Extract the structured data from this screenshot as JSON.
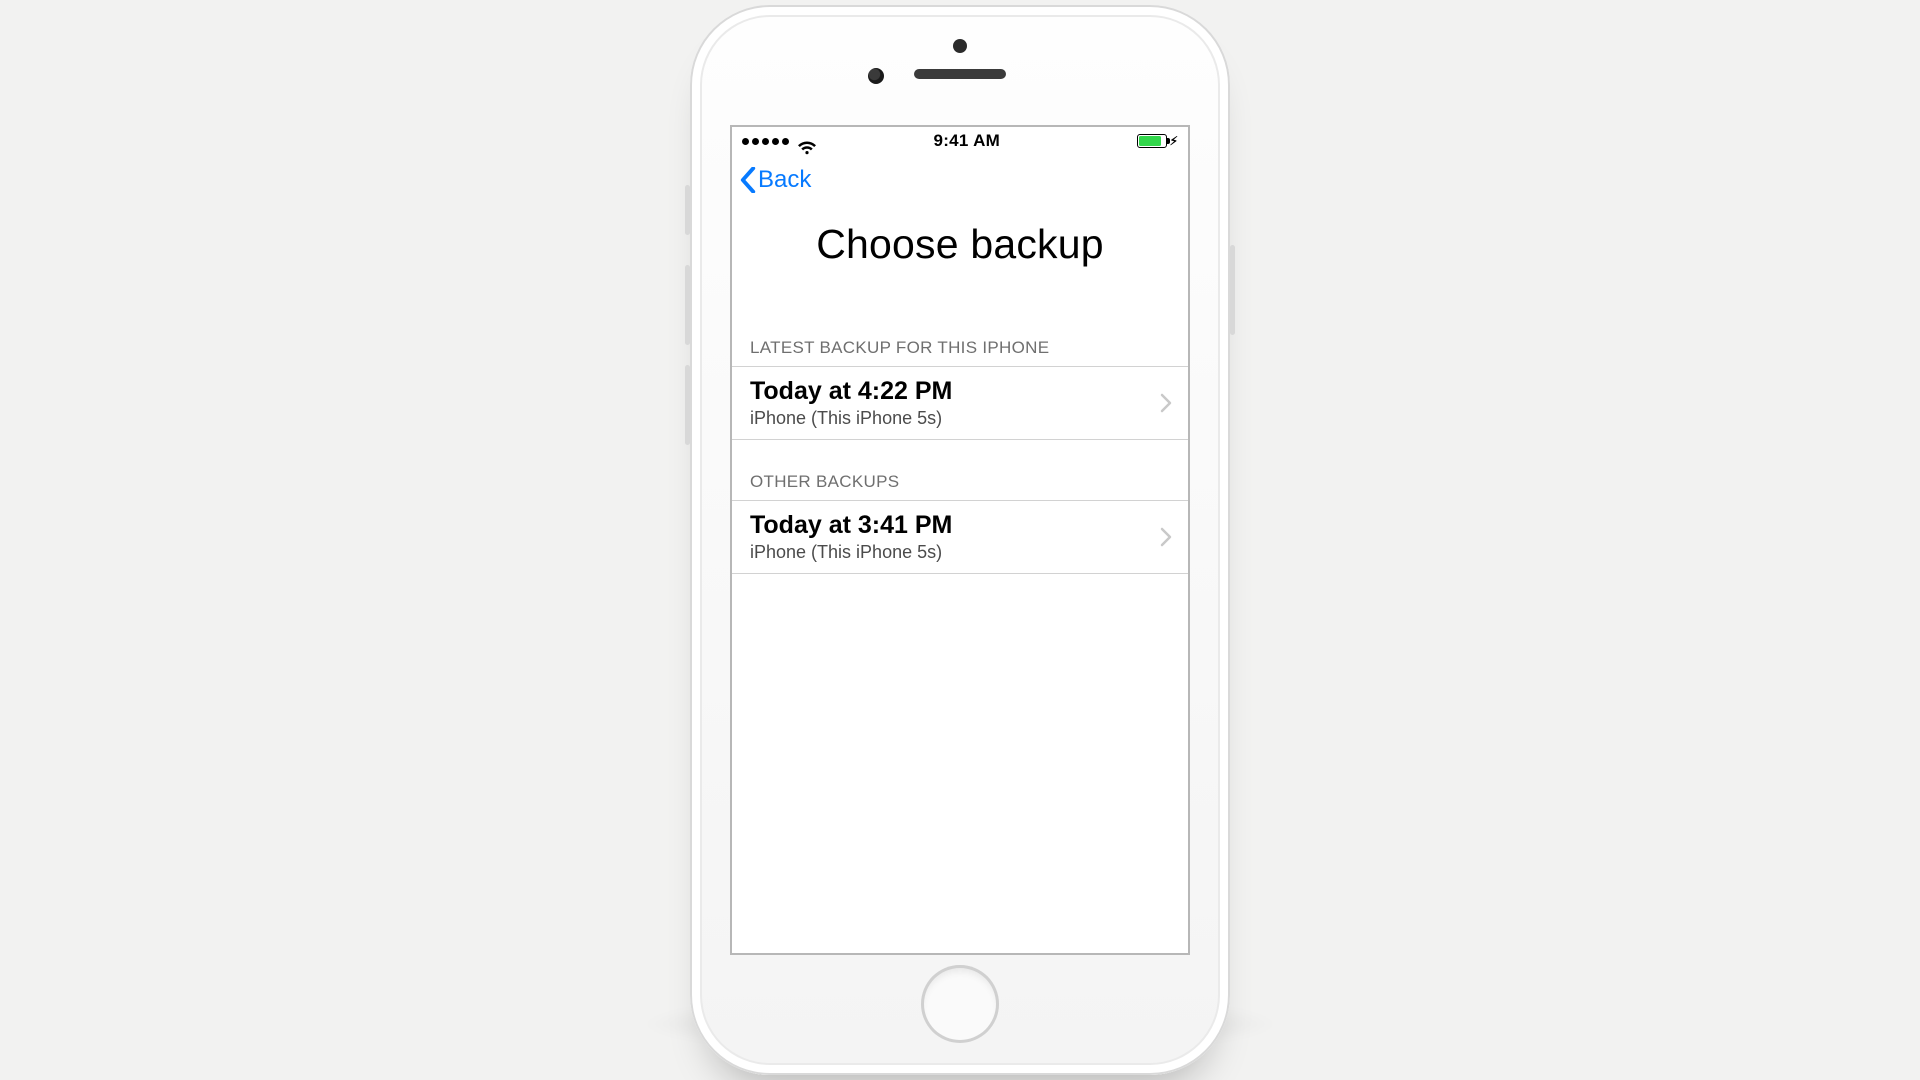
{
  "statusbar": {
    "time": "9:41 AM",
    "battery_color": "#32d74b"
  },
  "nav": {
    "back_label": "Back"
  },
  "page": {
    "title": "Choose backup"
  },
  "sections": [
    {
      "header": "LATEST BACKUP FOR THIS IPHONE",
      "rows": [
        {
          "primary": "Today at 4:22 PM",
          "secondary": "iPhone (This iPhone 5s)"
        }
      ]
    },
    {
      "header": "OTHER BACKUPS",
      "rows": [
        {
          "primary": "Today at 3:41 PM",
          "secondary": "iPhone (This iPhone 5s)"
        }
      ]
    }
  ]
}
